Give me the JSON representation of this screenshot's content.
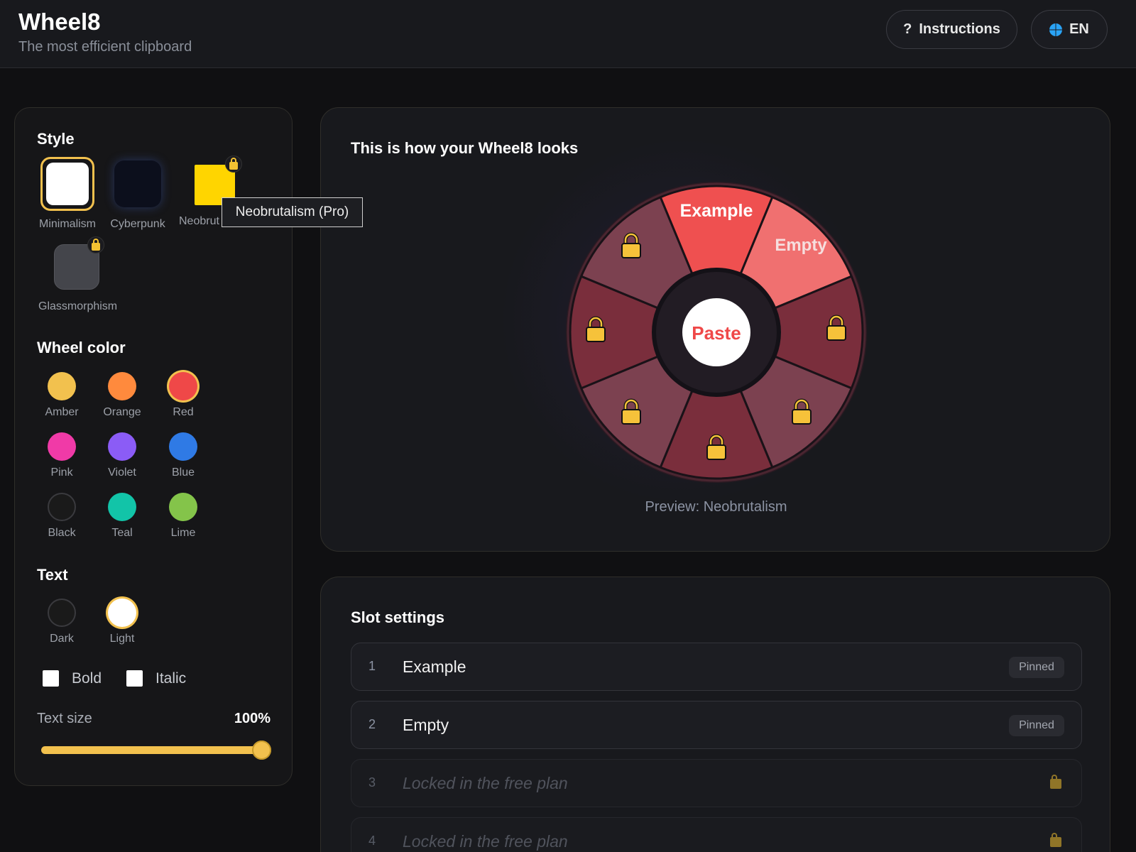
{
  "header": {
    "title": "Wheel8",
    "subtitle": "The most efficient clipboard",
    "instructions_label": "Instructions",
    "instructions_icon": "?",
    "lang_label": "EN"
  },
  "style_section": {
    "title": "Style",
    "options": [
      {
        "label": "Minimalism",
        "selected": true,
        "locked": false,
        "color": "#ffffff"
      },
      {
        "label": "Cyberpunk",
        "selected": false,
        "locked": false,
        "color": "#0c0f1c"
      },
      {
        "label": "Neobrut",
        "selected": false,
        "locked": true,
        "color": "#ffd500"
      },
      {
        "label": "Glassmorphism",
        "selected": false,
        "locked": true,
        "color": "#44454b"
      }
    ],
    "tooltip": "Neobrutalism (Pro)"
  },
  "wheel_color": {
    "title": "Wheel color",
    "options": [
      {
        "label": "Amber",
        "color": "#f2c14e"
      },
      {
        "label": "Orange",
        "color": "#ff8a3d"
      },
      {
        "label": "Red",
        "color": "#ef4848",
        "selected": true
      },
      {
        "label": "Pink",
        "color": "#f03aa7"
      },
      {
        "label": "Violet",
        "color": "#8b5cf6"
      },
      {
        "label": "Blue",
        "color": "#2f7ae5"
      },
      {
        "label": "Black",
        "color": "#1a1a1a"
      },
      {
        "label": "Teal",
        "color": "#12c4a8"
      },
      {
        "label": "Lime",
        "color": "#84c44a"
      }
    ]
  },
  "text_section": {
    "title": "Text",
    "options": [
      {
        "label": "Dark",
        "color": "#1a1a1a"
      },
      {
        "label": "Light",
        "color": "#ffffff",
        "selected": true
      }
    ],
    "bold_label": "Bold",
    "italic_label": "Italic",
    "size_label": "Text size",
    "size_value": "100%",
    "size_fraction": 1.0
  },
  "preview": {
    "title": "This is how your Wheel8 looks",
    "center_label": "Paste",
    "segment_labels": [
      "Example",
      "Empty"
    ],
    "caption": "Preview: Neobrutalism"
  },
  "slots": {
    "title": "Slot settings",
    "items": [
      {
        "num": "1",
        "text": "Example",
        "badge": "Pinned",
        "locked": false
      },
      {
        "num": "2",
        "text": "Empty",
        "badge": "Pinned",
        "locked": false
      },
      {
        "num": "3",
        "text": "Locked in the free plan",
        "badge": "",
        "locked": true
      },
      {
        "num": "4",
        "text": "Locked in the free plan",
        "badge": "",
        "locked": true
      }
    ]
  },
  "colors": {
    "accent": "#f2c14e",
    "wheel_active": "#ef5050",
    "wheel_light": "#f07070"
  }
}
